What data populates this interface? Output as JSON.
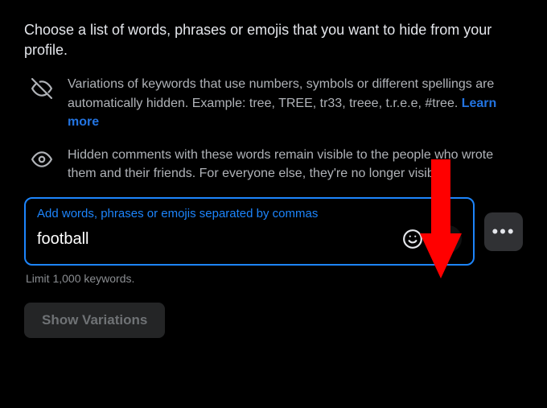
{
  "intro": "Choose a list of words, phrases or emojis that you want to hide from your profile.",
  "info1": {
    "text": "Variations of keywords that use numbers, symbols or different spellings are automatically hidden. Example: tree, TREE, tr33, treee, t.r.e.e, #tree. ",
    "learn_more": "Learn more"
  },
  "info2": {
    "text": "Hidden comments with these words remain visible to the people who wrote them and their friends. For everyone else, they're no longer visible."
  },
  "input": {
    "label": "Add words, phrases or emojis separated by commas",
    "value": "football"
  },
  "limit": "Limit 1,000 keywords.",
  "show_variations": "Show Variations"
}
